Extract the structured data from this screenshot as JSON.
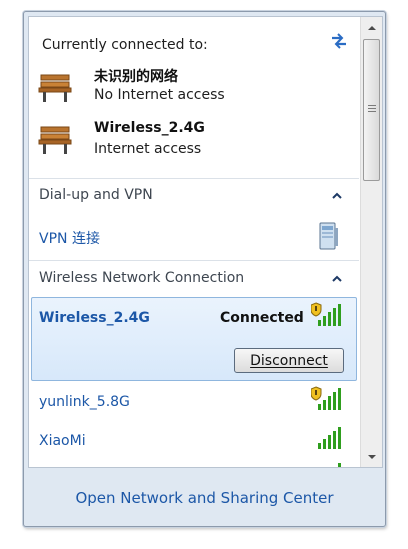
{
  "header": {
    "title": "Currently connected to:",
    "refresh_icon": "refresh-arrows-icon"
  },
  "connected_networks": [
    {
      "name": "未识别的网络",
      "status": "No Internet access",
      "icon": "network-bench-icon"
    },
    {
      "name": "Wireless_2.4G",
      "status": "Internet access",
      "icon": "network-bench-icon"
    }
  ],
  "dialup": {
    "header": "Dial-up and VPN",
    "item": "VPN 连接",
    "icon": "vpn-device-icon"
  },
  "wireless": {
    "header": "Wireless Network Connection",
    "selected": {
      "name": "Wireless_2.4G",
      "status": "Connected",
      "button": "Disconnect"
    },
    "networks": [
      {
        "name": "yunlink_5.8G",
        "secured": true,
        "signal_bars": 5
      },
      {
        "name": "XiaoMi",
        "secured": false,
        "signal_bars": 5
      }
    ]
  },
  "footer": {
    "link": "Open Network and Sharing Center"
  },
  "colors": {
    "link_blue": "#1c57a7",
    "signal_green": "#2f9e1e",
    "selection_border": "#8fb6de",
    "shield_gold": "#f0c020"
  }
}
